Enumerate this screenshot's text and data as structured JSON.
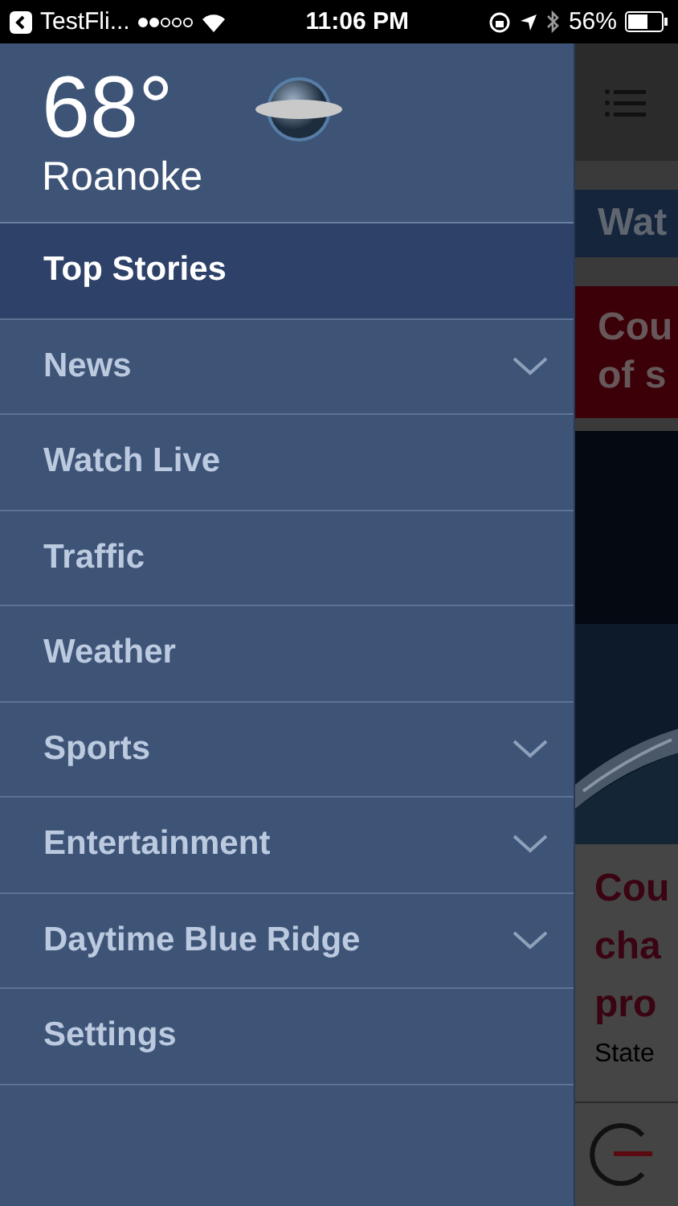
{
  "status_bar": {
    "back_label": "TestFli...",
    "time": "11:06 PM",
    "battery": "56%"
  },
  "drawer": {
    "temperature": "68°",
    "city": "Roanoke",
    "items": [
      {
        "label": "Top Stories",
        "selected": true,
        "expandable": false
      },
      {
        "label": "News",
        "selected": false,
        "expandable": true
      },
      {
        "label": "Watch Live",
        "selected": false,
        "expandable": false
      },
      {
        "label": "Traffic",
        "selected": false,
        "expandable": false
      },
      {
        "label": "Weather",
        "selected": false,
        "expandable": false
      },
      {
        "label": "Sports",
        "selected": false,
        "expandable": true
      },
      {
        "label": "Entertainment",
        "selected": false,
        "expandable": true
      },
      {
        "label": "Daytime Blue Ridge",
        "selected": false,
        "expandable": true
      },
      {
        "label": "Settings",
        "selected": false,
        "expandable": false
      }
    ]
  },
  "content": {
    "banner": "Wat",
    "alert_lines": [
      "Cou",
      "of s"
    ],
    "headline_lines": [
      "Cou",
      "cha",
      "pro"
    ],
    "summary": "State"
  }
}
